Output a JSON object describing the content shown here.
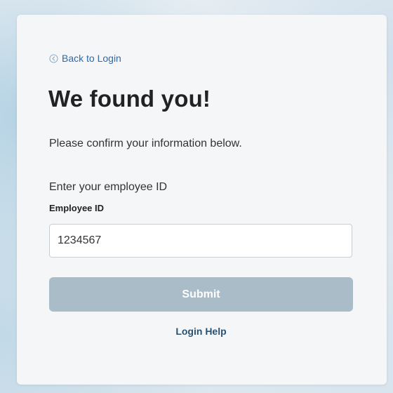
{
  "nav": {
    "back_label": "Back to Login",
    "back_icon": "chevron-left-circle-icon"
  },
  "header": {
    "title": "We found you!",
    "subtitle": "Please confirm your information below."
  },
  "form": {
    "prompt": "Enter your employee ID",
    "field_label": "Employee ID",
    "employee_id_value": "1234567",
    "submit_label": "Submit",
    "help_label": "Login Help"
  },
  "colors": {
    "link": "#2f6aa6",
    "submit_bg_disabled": "#a9bcc8",
    "help_link": "#2b5170",
    "card_bg": "#f4f6f8"
  }
}
